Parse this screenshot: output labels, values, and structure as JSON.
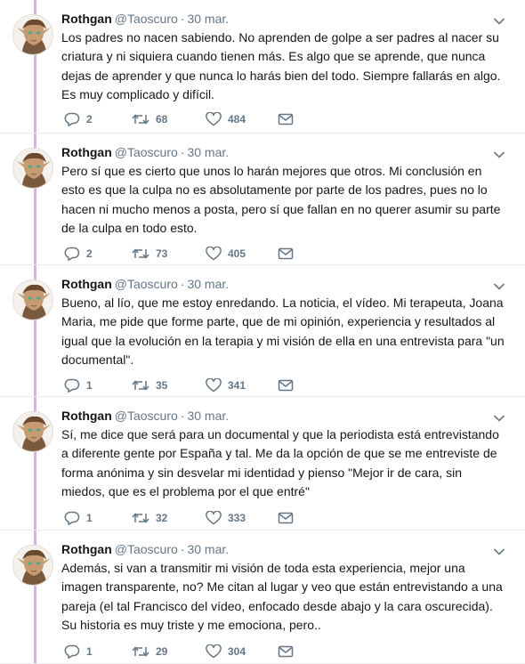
{
  "colors": {
    "thread_line": "#d7b3e3",
    "icon_gray": "#657786",
    "text": "#14171a"
  },
  "icons": {
    "reply": "reply-icon",
    "retweet": "retweet-icon",
    "like": "heart-icon",
    "dm": "envelope-icon",
    "menu": "chevron-down-icon"
  },
  "tweets": [
    {
      "name": "Rothgan",
      "handle": "@Taoscuro",
      "dot": "·",
      "date": "30 mar.",
      "lines": [
        "Los padres no nacen sabiendo. No aprenden de golpe a ser padres al nacer su",
        "criatura y ni siquiera cuando tienen más. Es algo que se aprende, que nunca",
        "dejas de aprender y que nunca lo harás bien del todo. Siempre fallarás en algo.",
        "Es muy complicado y difícil."
      ],
      "replies": "2",
      "retweets": "68",
      "likes": "484"
    },
    {
      "name": "Rothgan",
      "handle": "@Taoscuro",
      "dot": "·",
      "date": "30 mar.",
      "lines": [
        "Pero sí que es cierto que unos lo harán mejores que otros. Mi conclusión en",
        "esto es que la culpa no es absolutamente por parte de los padres, pues no lo",
        "hacen ni mucho menos a posta, pero sí que fallan en no querer asumir su parte",
        "de la culpa en todo esto."
      ],
      "replies": "2",
      "retweets": "73",
      "likes": "405"
    },
    {
      "name": "Rothgan",
      "handle": "@Taoscuro",
      "dot": "·",
      "date": "30 mar.",
      "lines": [
        "Bueno, al lío, que me estoy enredando. La noticia, el vídeo. Mi terapeuta, Joana",
        "Maria, me pide que forme parte, que de mi opinión, experiencia y resultados al",
        "igual que la evolución en la terapia y mi visión de ella en una entrevista para \"un",
        "documental\"."
      ],
      "replies": "1",
      "retweets": "35",
      "likes": "341"
    },
    {
      "name": "Rothgan",
      "handle": "@Taoscuro",
      "dot": "·",
      "date": "30 mar.",
      "lines": [
        "Sí, me dice que será para un documental y que la periodista está entrevistando",
        "a diferente gente por España y tal. Me da la opción de que se me entreviste de",
        "forma anónima y sin desvelar mi identidad y pienso \"Mejor ir de cara, sin",
        "miedos, que es el problema por el que entré\""
      ],
      "replies": "1",
      "retweets": "32",
      "likes": "333"
    },
    {
      "name": "Rothgan",
      "handle": "@Taoscuro",
      "dot": "·",
      "date": "30 mar.",
      "lines": [
        "Además, si van a transmitir mi visión de toda esta experiencia, mejor una",
        "imagen transparente, no? Me citan al lugar y veo que están entrevistando a una",
        "pareja (el tal Francisco del vídeo, enfocado desde abajo y la cara oscurecida).",
        "Su historia es muy triste y me emociona, pero.."
      ],
      "replies": "1",
      "retweets": "29",
      "likes": "304"
    }
  ]
}
